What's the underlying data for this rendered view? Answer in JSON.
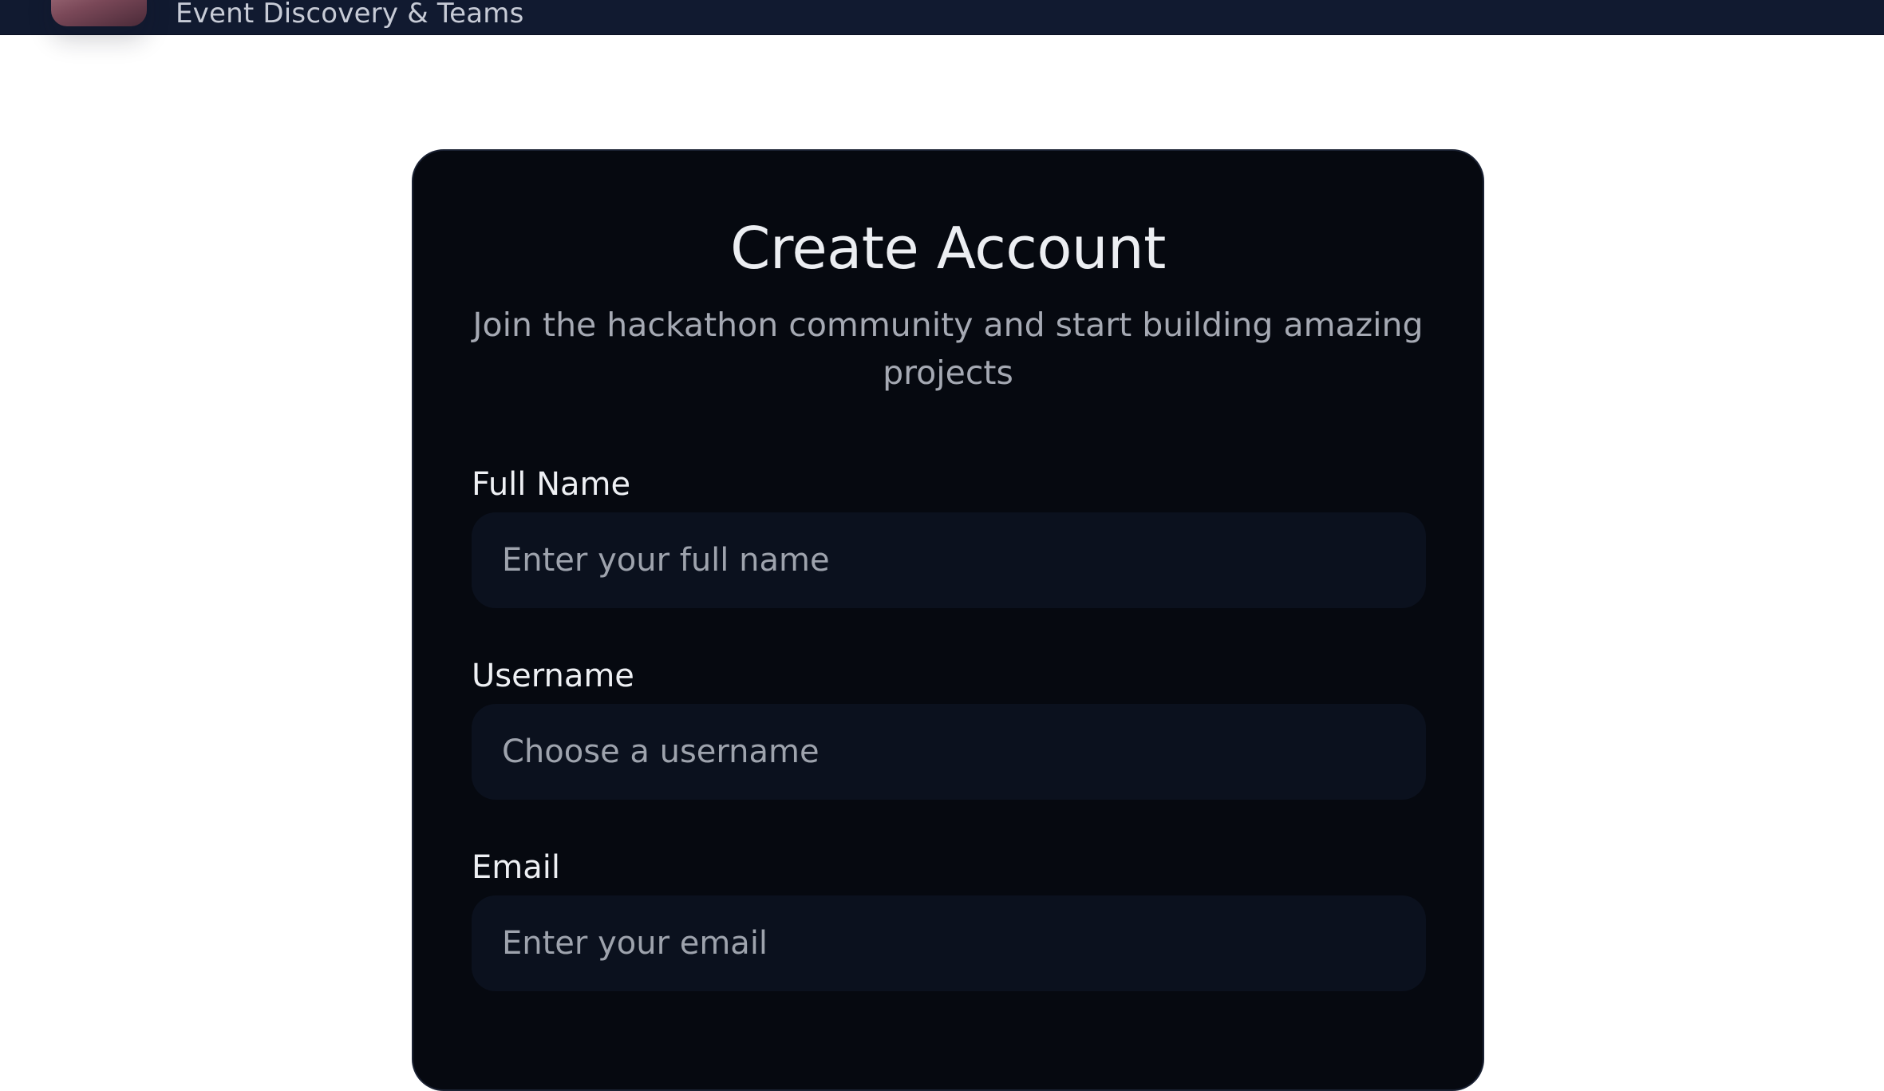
{
  "header": {
    "brand_subtitle": "Event Discovery & Teams",
    "logo_icon": "app-logo-icon"
  },
  "signup": {
    "title": "Create Account",
    "subtitle": "Join the hackathon community and start building amazing projects",
    "fields": [
      {
        "label": "Full Name",
        "placeholder": "Enter your full name",
        "value": ""
      },
      {
        "label": "Username",
        "placeholder": "Choose a username",
        "value": ""
      },
      {
        "label": "Email",
        "placeholder": "Enter your email",
        "value": ""
      }
    ]
  },
  "colors": {
    "topbar": "#111a30",
    "card": "#060910",
    "input_bg": "#0b111e",
    "title_text": "#eceef2",
    "muted_text": "#a5a9b3"
  }
}
